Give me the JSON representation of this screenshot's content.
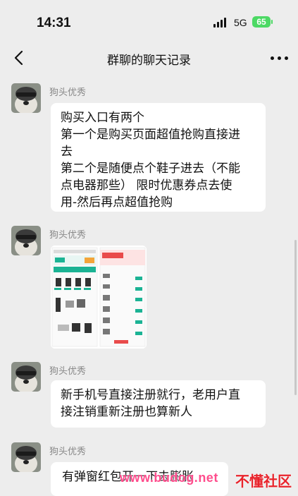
{
  "status_bar": {
    "time": "14:31",
    "network": "5G",
    "battery": "65"
  },
  "nav": {
    "title": "群聊的聊天记录"
  },
  "messages": [
    {
      "sender": "狗头优秀",
      "type": "text",
      "lines": [
        "购买入口有两个",
        "第一个是购买页面超值抢购直接进",
        "去",
        "第二个是随便点个鞋子进去（不能",
        "点电器那些） 限时优惠券点去使",
        "用-然后再点超值抢购"
      ]
    },
    {
      "sender": "狗头优秀",
      "type": "image",
      "image": {
        "left_header": "新人超值抢购",
        "right_header": "新人超值好物",
        "right_tag": "超值抢购"
      }
    },
    {
      "sender": "狗头优秀",
      "type": "text",
      "lines": [
        "新手机号直接注册就行，老用户直",
        "接注销重新注册也算新人"
      ]
    },
    {
      "sender": "狗头优秀",
      "type": "text",
      "lines": [
        "有弹窗红包开一下去膨胀"
      ]
    }
  ],
  "watermark": {
    "site": "www.budog.net",
    "label": "不懂社区"
  },
  "colors": {
    "background": "#ededed",
    "bubble": "#ffffff",
    "battery": "#4cd964",
    "sender": "#888888"
  }
}
